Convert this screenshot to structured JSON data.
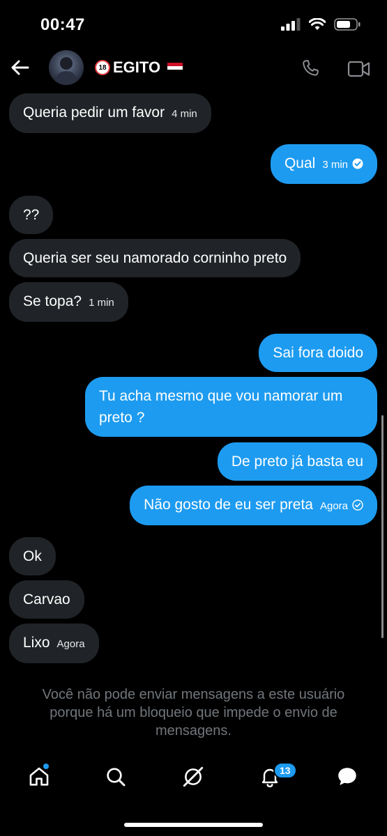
{
  "status_bar": {
    "time": "00:47"
  },
  "header": {
    "contact_name": "EGITO",
    "age_badge": "18"
  },
  "messages": [
    {
      "dir": "in",
      "text": "Queria pedir um favor",
      "time": "4 min"
    },
    {
      "dir": "out",
      "text": "Qual",
      "time": "3 min"
    },
    {
      "dir": "in",
      "text": "??"
    },
    {
      "dir": "in",
      "text": "Queria ser seu namorado corninho preto"
    },
    {
      "dir": "in",
      "text": "Se topa?",
      "time": "1 min"
    },
    {
      "dir": "out",
      "text": "Sai fora doido"
    },
    {
      "dir": "out",
      "text": "Tu acha mesmo que vou namorar um preto ?"
    },
    {
      "dir": "out",
      "text": "De preto já basta eu"
    },
    {
      "dir": "out",
      "text": "Não gosto de eu ser preta",
      "time": "Agora"
    },
    {
      "dir": "in",
      "text": "Ok"
    },
    {
      "dir": "in",
      "text": "Carvao"
    },
    {
      "dir": "in",
      "text": "Lixo",
      "time": "Agora"
    }
  ],
  "blocked_notice": "Você não pode enviar mensagens a este usuário porque há um bloqueio que impede o envio de mensagens.",
  "tab_bar": {
    "notifications_badge": "13"
  },
  "colors": {
    "accent": "#1d9bf0",
    "incoming_bubble": "#202327",
    "background": "#000000",
    "muted_text": "#71767b"
  }
}
